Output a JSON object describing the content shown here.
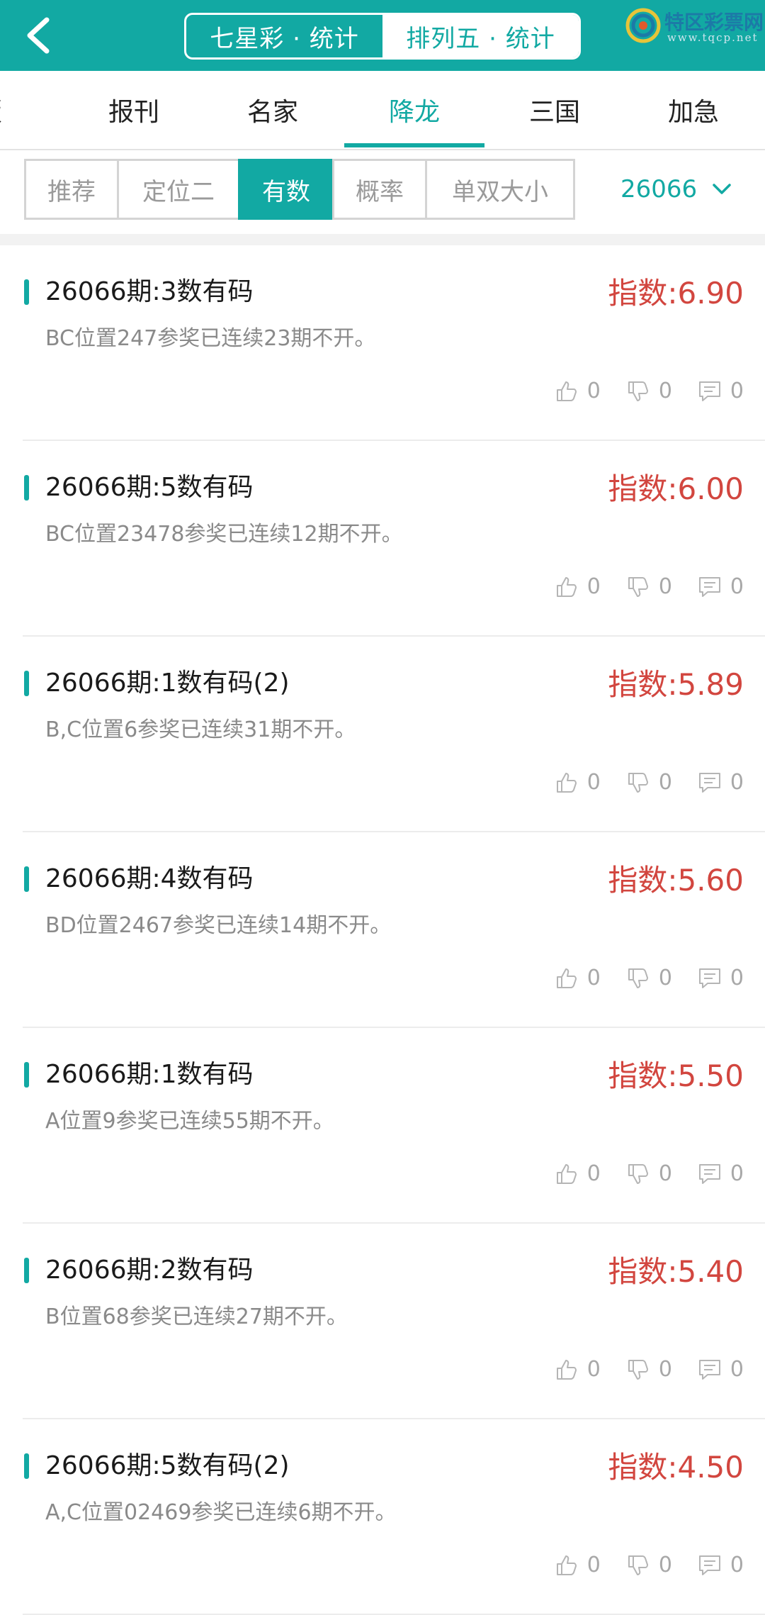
{
  "header": {
    "segments": [
      {
        "label": "七星彩 · 统计",
        "selected": false
      },
      {
        "label": "排列五 · 统计",
        "selected": true
      }
    ],
    "logo": {
      "brand": "特区彩票网",
      "site": "www.tqcp.net"
    }
  },
  "categories": [
    "版",
    "报刊",
    "名家",
    "降龙",
    "三国",
    "加急"
  ],
  "active_category": "降龙",
  "subtabs": [
    "推荐",
    "定位二",
    "有数",
    "概率",
    "单双大小"
  ],
  "active_subtab": "有数",
  "period": "26066",
  "items": [
    {
      "title": "26066期:3数有码",
      "index": "指数:6.90",
      "desc": "BC位置247参奖已连续23期不开。",
      "likes": "0",
      "dislikes": "0",
      "comments": "0"
    },
    {
      "title": "26066期:5数有码",
      "index": "指数:6.00",
      "desc": "BC位置23478参奖已连续12期不开。",
      "likes": "0",
      "dislikes": "0",
      "comments": "0"
    },
    {
      "title": "26066期:1数有码(2)",
      "index": "指数:5.89",
      "desc": "B,C位置6参奖已连续31期不开。",
      "likes": "0",
      "dislikes": "0",
      "comments": "0"
    },
    {
      "title": "26066期:4数有码",
      "index": "指数:5.60",
      "desc": "BD位置2467参奖已连续14期不开。",
      "likes": "0",
      "dislikes": "0",
      "comments": "0"
    },
    {
      "title": "26066期:1数有码",
      "index": "指数:5.50",
      "desc": "A位置9参奖已连续55期不开。",
      "likes": "0",
      "dislikes": "0",
      "comments": "0"
    },
    {
      "title": "26066期:2数有码",
      "index": "指数:5.40",
      "desc": "B位置68参奖已连续27期不开。",
      "likes": "0",
      "dislikes": "0",
      "comments": "0"
    },
    {
      "title": "26066期:5数有码(2)",
      "index": "指数:4.50",
      "desc": "A,C位置02469参奖已连续6期不开。",
      "likes": "0",
      "dislikes": "0",
      "comments": "0"
    }
  ],
  "colors": {
    "accent": "#12a9a3",
    "index_red": "#d2463f"
  }
}
